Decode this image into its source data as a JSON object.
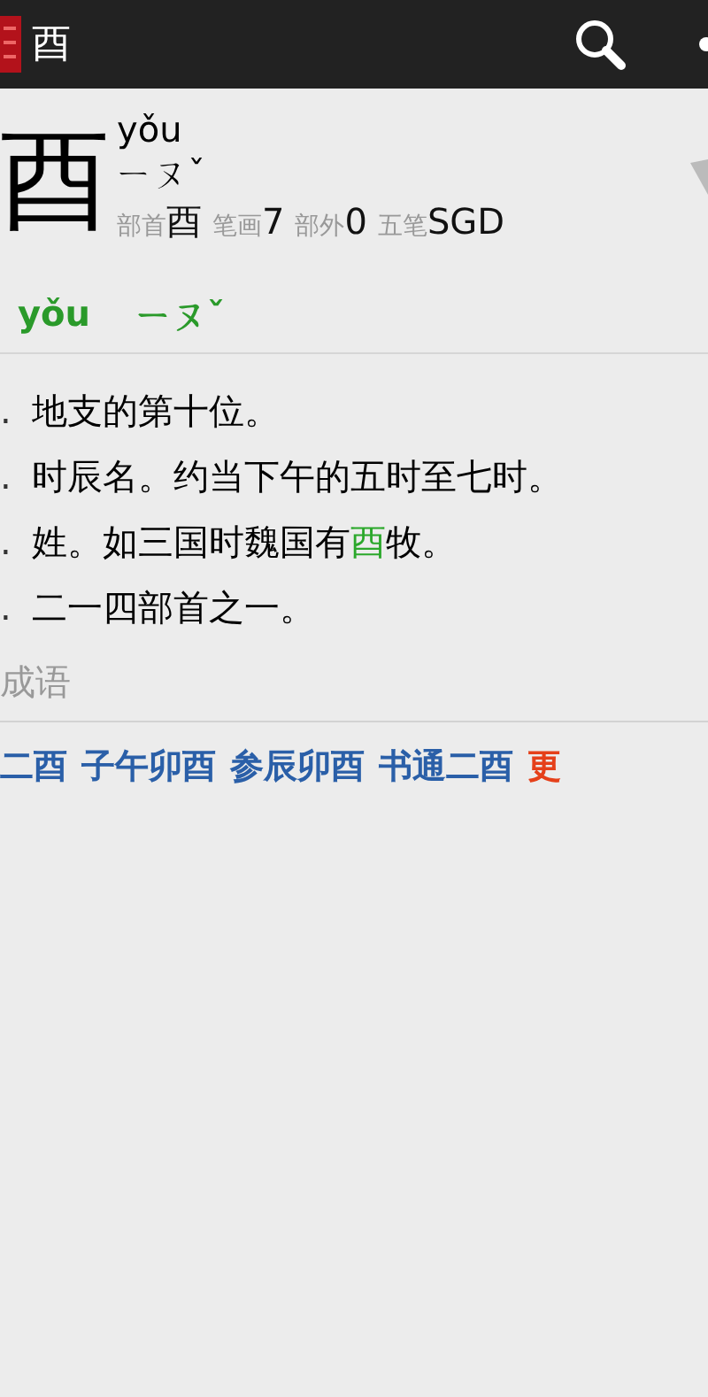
{
  "app_bar": {
    "title": "酉"
  },
  "entry": {
    "character": "酉",
    "pinyin": "yǒu",
    "zhuyin": "ㄧㄡˇ",
    "stats": [
      {
        "label": "部首",
        "value": "酉"
      },
      {
        "label": "笔画",
        "value": "7"
      },
      {
        "label": "部外",
        "value": "0"
      },
      {
        "label": "五笔",
        "value": "SGD"
      }
    ]
  },
  "reading": {
    "pinyin": "yǒu",
    "zhuyin": "ㄧㄡˇ"
  },
  "definitions": [
    {
      "number": ".",
      "text": "地支的第十位。"
    },
    {
      "number": ".",
      "text": "时辰名。约当下午的五时至七时。"
    },
    {
      "number": ".",
      "text": "姓。如三国时魏国有**酉**牧。"
    },
    {
      "number": ".",
      "text": "二一四部首之一。"
    }
  ],
  "idioms": {
    "heading": "成语",
    "items": [
      {
        "text": "二酉",
        "kind": "idiom"
      },
      {
        "text": "子午卯酉",
        "kind": "idiom"
      },
      {
        "text": "参辰卯酉",
        "kind": "idiom"
      },
      {
        "text": "书通二酉",
        "kind": "idiom"
      },
      {
        "text": "更",
        "kind": "more"
      }
    ]
  }
}
